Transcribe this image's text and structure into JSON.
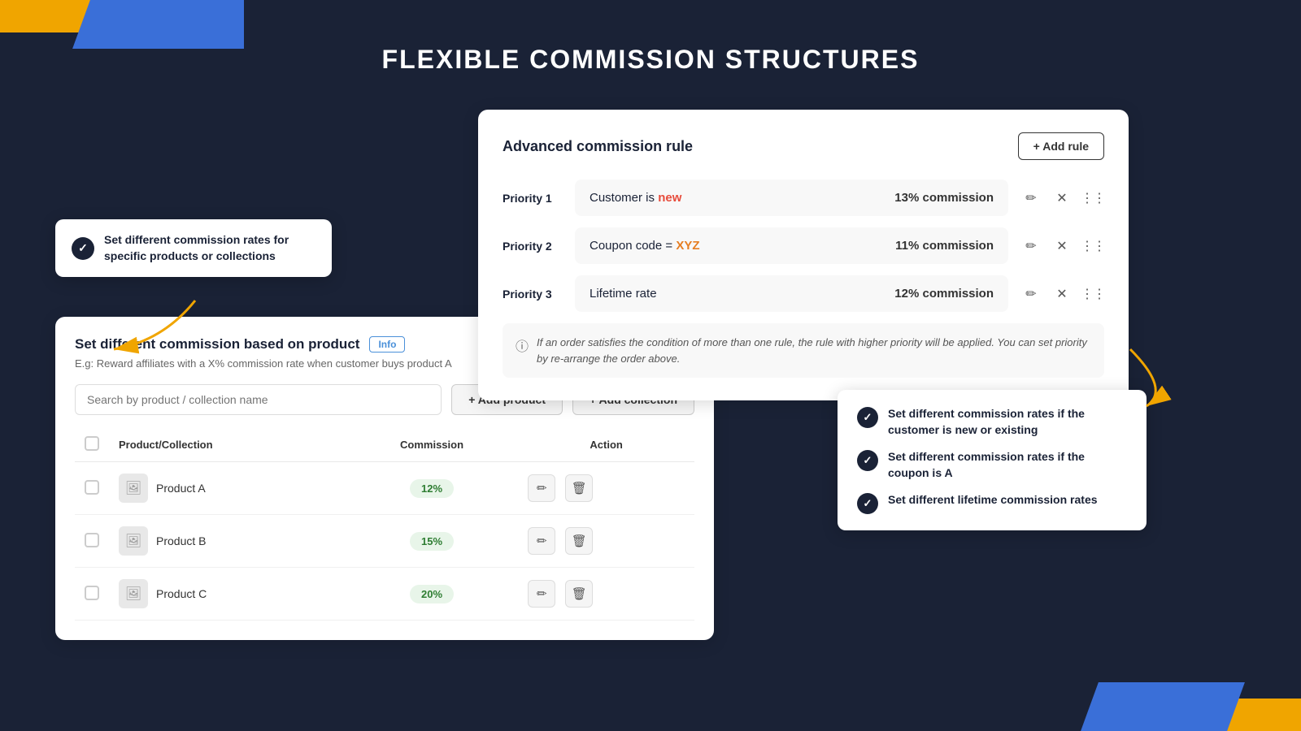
{
  "page": {
    "title": "FLEXIBLE COMMISSION STRUCTURES",
    "bg_color": "#1a2236"
  },
  "tooltip_products": {
    "text": "Set different commission rates for specific products or collections"
  },
  "product_card": {
    "title": "Set different commission based on product",
    "info_label": "Info",
    "subtitle": "E.g: Reward affiliates with a X% commission rate when customer buys product A",
    "search_placeholder": "Search by product / collection name",
    "btn_add_product": "+ Add product",
    "btn_add_collection": "+ Add collection",
    "table": {
      "columns": [
        "",
        "Product/Collection",
        "Commission",
        "Action"
      ],
      "rows": [
        {
          "name": "Product A",
          "commission": "12%"
        },
        {
          "name": "Product B",
          "commission": "15%"
        },
        {
          "name": "Product C",
          "commission": "20%"
        }
      ]
    }
  },
  "advanced_card": {
    "title": "Advanced commission rule",
    "btn_add_rule": "+ Add rule",
    "priorities": [
      {
        "label": "Priority 1",
        "description_prefix": "Customer is ",
        "highlight": "new",
        "highlight_color": "#e74c3c",
        "commission": "13% commission"
      },
      {
        "label": "Priority 2",
        "description_prefix": "Coupon code = ",
        "highlight": "XYZ",
        "highlight_color": "#e67e22",
        "commission": "11% commission"
      },
      {
        "label": "Priority 3",
        "description_prefix": "Lifetime rate",
        "highlight": "",
        "highlight_color": "",
        "commission": "12% commission"
      }
    ],
    "note": "If an order satisfies the condition of more than one rule, the rule with higher priority will be applied. You can set priority by re-arrange the order above."
  },
  "tooltip_rules": {
    "items": [
      "Set different commission rates if the customer is new or existing",
      "Set different commission rates if the coupon is A",
      "Set different lifetime commission rates"
    ]
  },
  "icons": {
    "edit": "✏",
    "delete": "🗑",
    "close": "✕",
    "drag": "⋮⋮",
    "info": "ⓘ",
    "image": "🖼"
  }
}
